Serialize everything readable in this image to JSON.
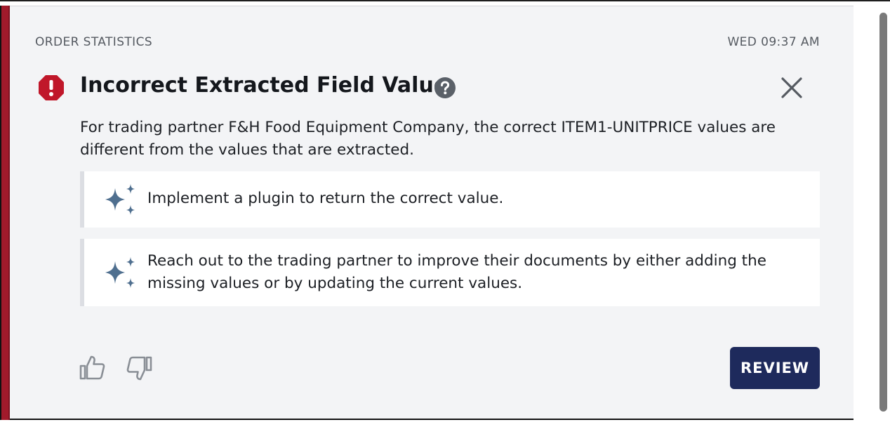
{
  "card": {
    "category": "ORDER STATISTICS",
    "timestamp": "WED 09:37 AM",
    "title": "Incorrect Extracted Field Value",
    "description": "For trading partner F&H Food Equipment Company, the correct ITEM1-UNITPRICE values are different from the values that are extracted.",
    "suggestions": [
      {
        "text": "Implement a plugin to return the correct value.",
        "icon": "sparkle-icon"
      },
      {
        "text": "Reach out to the trading partner to improve their documents by either adding the missing values or by updating the current values.",
        "icon": "sparkle-icon"
      }
    ],
    "review_label": "REVIEW"
  },
  "icons": {
    "alert": "alert-octagon-icon",
    "help": "help-circle-icon",
    "close": "close-icon",
    "thumbs_up": "thumbs-up-icon",
    "thumbs_down": "thumbs-down-icon"
  },
  "colors": {
    "accent_bar": "#a11a2b",
    "alert_icon": "#c0172a",
    "sparkle": "#4f6f8f",
    "review_button": "#1e2a5c",
    "card_background": "#f3f4f6"
  }
}
